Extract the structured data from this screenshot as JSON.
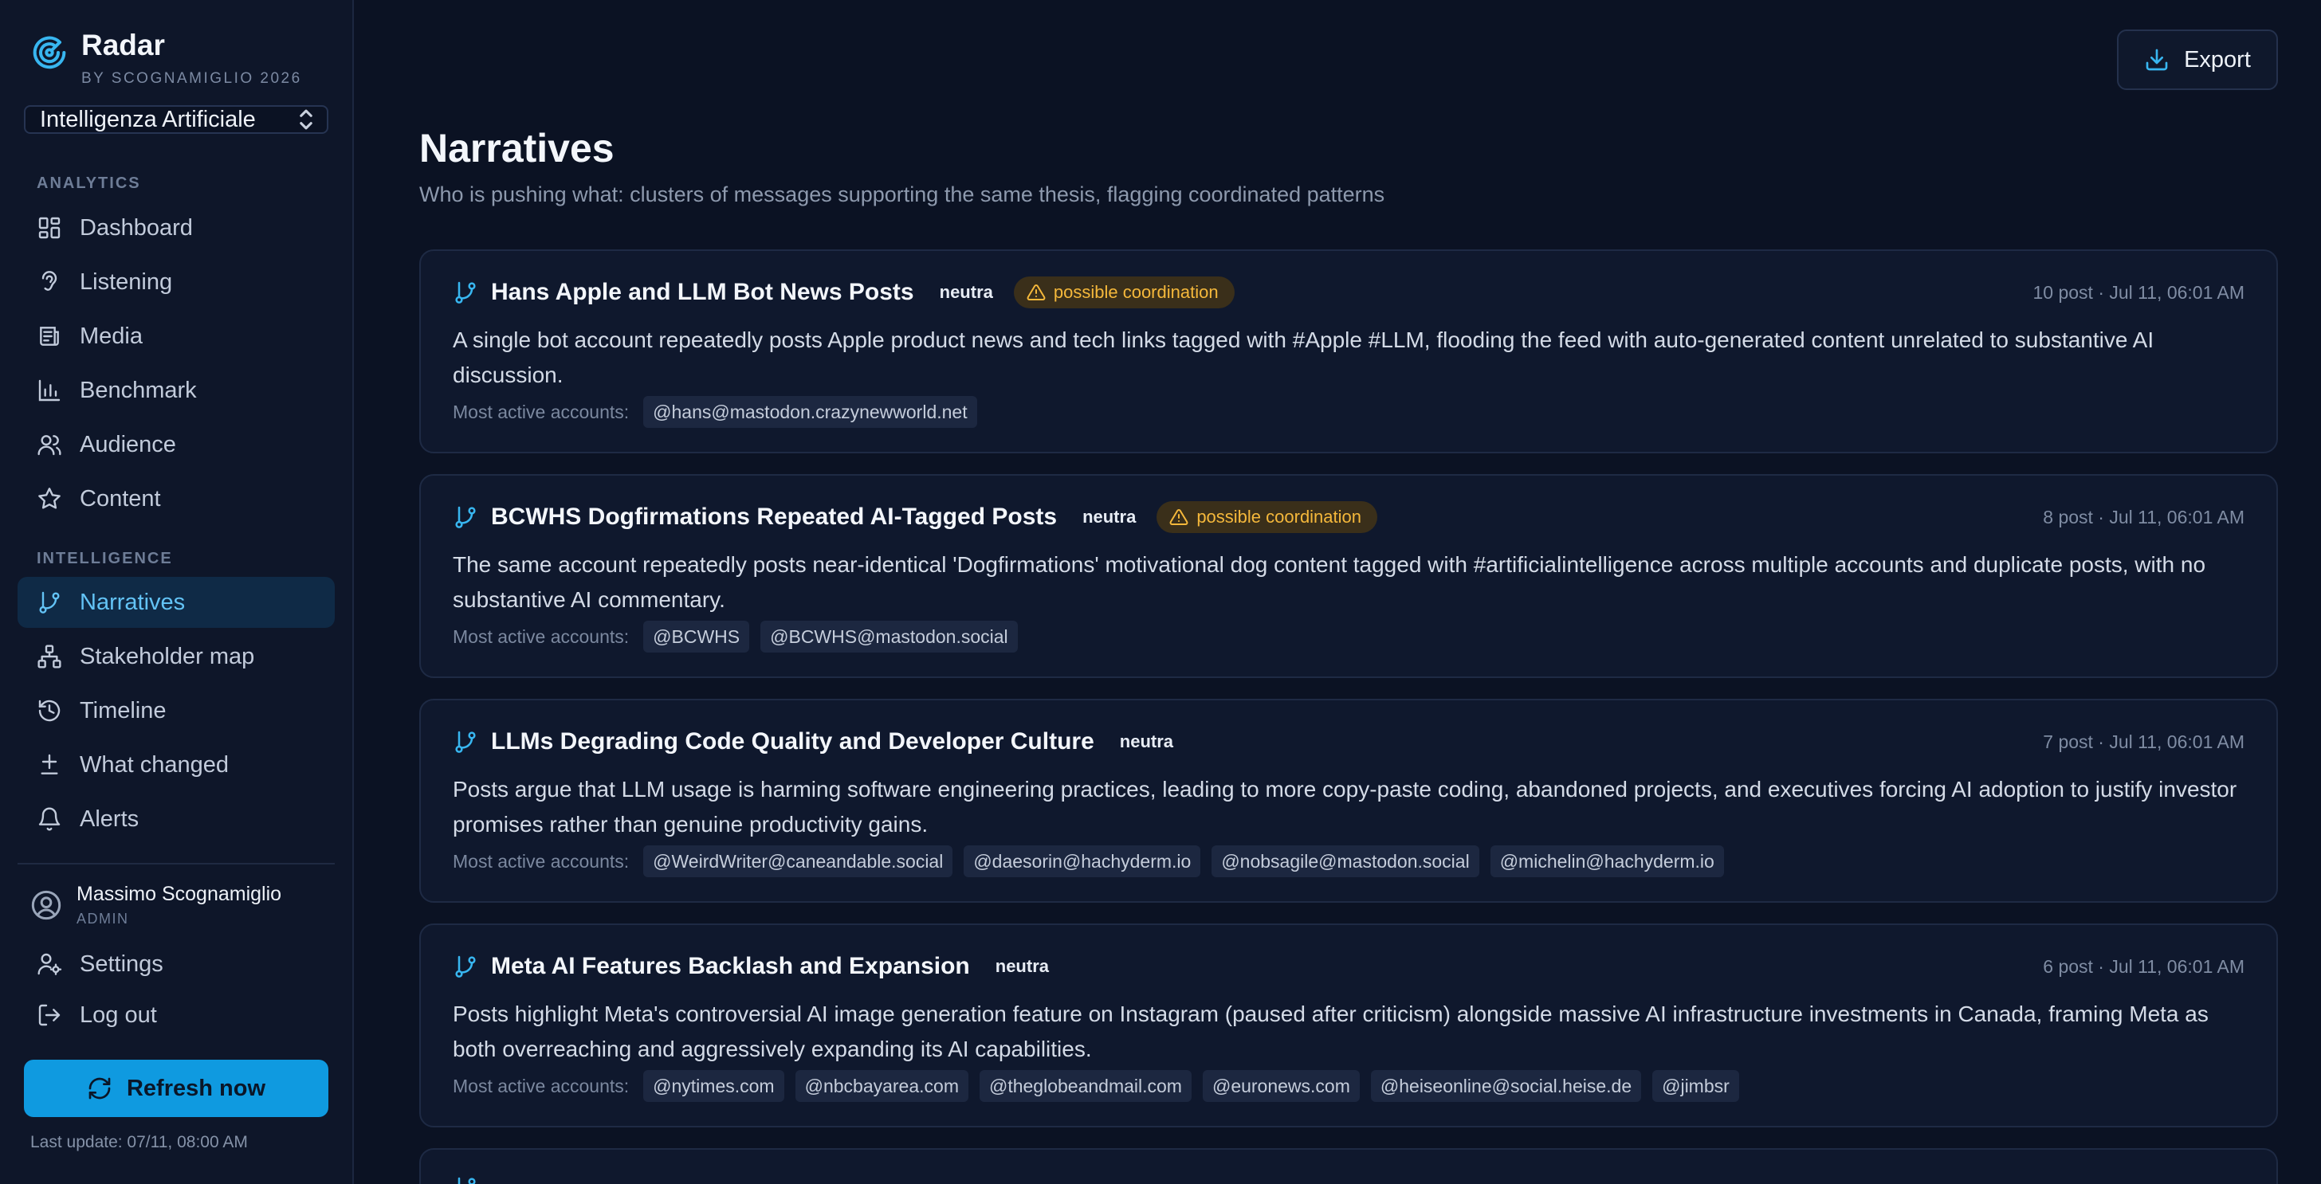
{
  "brand": {
    "title": "Radar",
    "subtitle": "BY SCOGNAMIGLIO 2026"
  },
  "workspace": {
    "selected": "Intelligenza Artificiale"
  },
  "nav": {
    "analytics_label": "ANALYTICS",
    "analytics": [
      {
        "label": "Dashboard",
        "icon": "grid-icon"
      },
      {
        "label": "Listening",
        "icon": "ear-icon"
      },
      {
        "label": "Media",
        "icon": "newspaper-icon"
      },
      {
        "label": "Benchmark",
        "icon": "bar-chart-icon"
      },
      {
        "label": "Audience",
        "icon": "users-icon"
      },
      {
        "label": "Content",
        "icon": "star-icon"
      }
    ],
    "intelligence_label": "INTELLIGENCE",
    "intelligence": [
      {
        "label": "Narratives",
        "icon": "branch-icon",
        "active": true
      },
      {
        "label": "Stakeholder map",
        "icon": "network-icon"
      },
      {
        "label": "Timeline",
        "icon": "history-icon"
      },
      {
        "label": "What changed",
        "icon": "diff-icon"
      },
      {
        "label": "Alerts",
        "icon": "bell-icon"
      }
    ]
  },
  "user": {
    "name": "Massimo Scognamiglio",
    "role": "ADMIN"
  },
  "footer_nav": {
    "settings": "Settings",
    "logout": "Log out"
  },
  "refresh": {
    "label": "Refresh now",
    "last_update": "Last update: 07/11, 08:00 AM"
  },
  "header": {
    "export_label": "Export",
    "title": "Narratives",
    "subtitle": "Who is pushing what: clusters of messages supporting the same thesis, flagging coordinated patterns"
  },
  "narratives": [
    {
      "title": "Hans Apple and LLM Bot News Posts",
      "tone": "neutra",
      "flag": "possible coordination",
      "meta": "10 post · Jul 11, 06:01 AM",
      "description": "A single bot account repeatedly posts Apple product news and tech links tagged with #Apple #LLM, flooding the feed with auto-generated content unrelated to substantive AI discussion.",
      "accounts_label": "Most active accounts:",
      "accounts": [
        "@hans@mastodon.crazynewworld.net"
      ]
    },
    {
      "title": "BCWHS Dogfirmations Repeated AI-Tagged Posts",
      "tone": "neutra",
      "flag": "possible coordination",
      "meta": "8 post · Jul 11, 06:01 AM",
      "description": "The same account repeatedly posts near-identical 'Dogfirmations' motivational dog content tagged with #artificialintelligence across multiple accounts and duplicate posts, with no substantive AI commentary.",
      "accounts_label": "Most active accounts:",
      "accounts": [
        "@BCWHS",
        "@BCWHS@mastodon.social"
      ]
    },
    {
      "title": "LLMs Degrading Code Quality and Developer Culture",
      "tone": "neutra",
      "flag": "",
      "meta": "7 post · Jul 11, 06:01 AM",
      "description": "Posts argue that LLM usage is harming software engineering practices, leading to more copy-paste coding, abandoned projects, and executives forcing AI adoption to justify investor promises rather than genuine productivity gains.",
      "accounts_label": "Most active accounts:",
      "accounts": [
        "@WeirdWriter@caneandable.social",
        "@daesorin@hachyderm.io",
        "@nobsagile@mastodon.social",
        "@michelin@hachyderm.io"
      ]
    },
    {
      "title": "Meta AI Features Backlash and Expansion",
      "tone": "neutra",
      "flag": "",
      "meta": "6 post · Jul 11, 06:01 AM",
      "description": "Posts highlight Meta's controversial AI image generation feature on Instagram (paused after criticism) alongside massive AI infrastructure investments in Canada, framing Meta as both overreaching and aggressively expanding its AI capabilities.",
      "accounts_label": "Most active accounts:",
      "accounts": [
        "@nytimes.com",
        "@nbcbayarea.com",
        "@theglobeandmail.com",
        "@euronews.com",
        "@heiseonline@social.heise.de",
        "@jimbsr"
      ]
    }
  ]
}
